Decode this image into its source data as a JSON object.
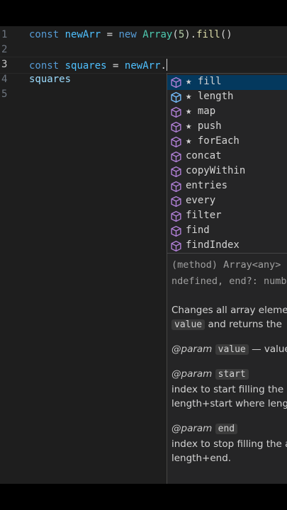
{
  "editor": {
    "line_numbers": [
      "1",
      "2",
      "3",
      "4",
      "5"
    ],
    "active_line": "3",
    "line1": {
      "kw": "const",
      "name": "newArr",
      "eq": "=",
      "kw2": "new",
      "cls": "Array",
      "open": "(",
      "num": "5",
      "close": ").",
      "fn": "fill",
      "parens": "()"
    },
    "line3": {
      "kw": "const",
      "name": "squares",
      "eq": "=",
      "obj": "newArr",
      "dot": "."
    },
    "line4": {
      "text": "squares"
    }
  },
  "suggest": {
    "items": [
      {
        "label": "fill",
        "starred": true
      },
      {
        "label": "length",
        "starred": true
      },
      {
        "label": "map",
        "starred": true
      },
      {
        "label": "push",
        "starred": true
      },
      {
        "label": "forEach",
        "starred": true
      },
      {
        "label": "concat",
        "starred": false
      },
      {
        "label": "copyWithin",
        "starred": false
      },
      {
        "label": "entries",
        "starred": false
      },
      {
        "label": "every",
        "starred": false
      },
      {
        "label": "filter",
        "starred": false
      },
      {
        "label": "find",
        "starred": false
      },
      {
        "label": "findIndex",
        "starred": false
      }
    ],
    "star": "★",
    "selected_index": 0,
    "icon_colors": {
      "method": "#b180d7",
      "property": "#75beff"
    }
  },
  "doc": {
    "sig1": "(method) Array<any>",
    "sig2": "ndefined, end?: numb",
    "desc1": "Changes all array elemen",
    "desc2_chip": "value",
    "desc2_rest": "and returns the",
    "param_tag": "@param",
    "p1_name": "value",
    "p1_rest": "— value",
    "p2_name": "start",
    "p2_l1": "index to start filling the a",
    "p2_l2": "length+start where lengt",
    "p3_name": "end",
    "p3_l1": "index to stop filling the a",
    "p3_l2": "length+end."
  }
}
